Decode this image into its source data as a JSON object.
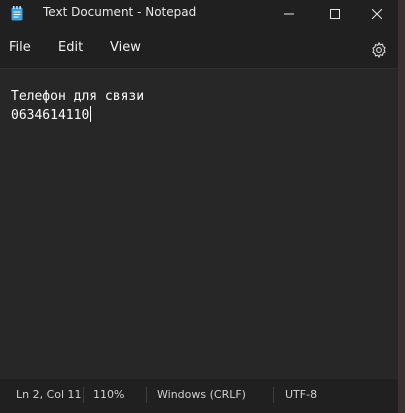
{
  "window": {
    "title": "Text Document - Notepad"
  },
  "menu": {
    "file": "File",
    "edit": "Edit",
    "view": "View"
  },
  "icons": [
    "notepad-app-icon",
    "minimize-icon",
    "maximize-icon",
    "close-icon",
    "settings-gear-icon"
  ],
  "editor": {
    "lines": [
      "Телефон для связи",
      "0634614110"
    ]
  },
  "status": {
    "position": "Ln 2, Col 11",
    "zoom": "110%",
    "line_ending": "Windows (CRLF)",
    "encoding": "UTF-8"
  }
}
